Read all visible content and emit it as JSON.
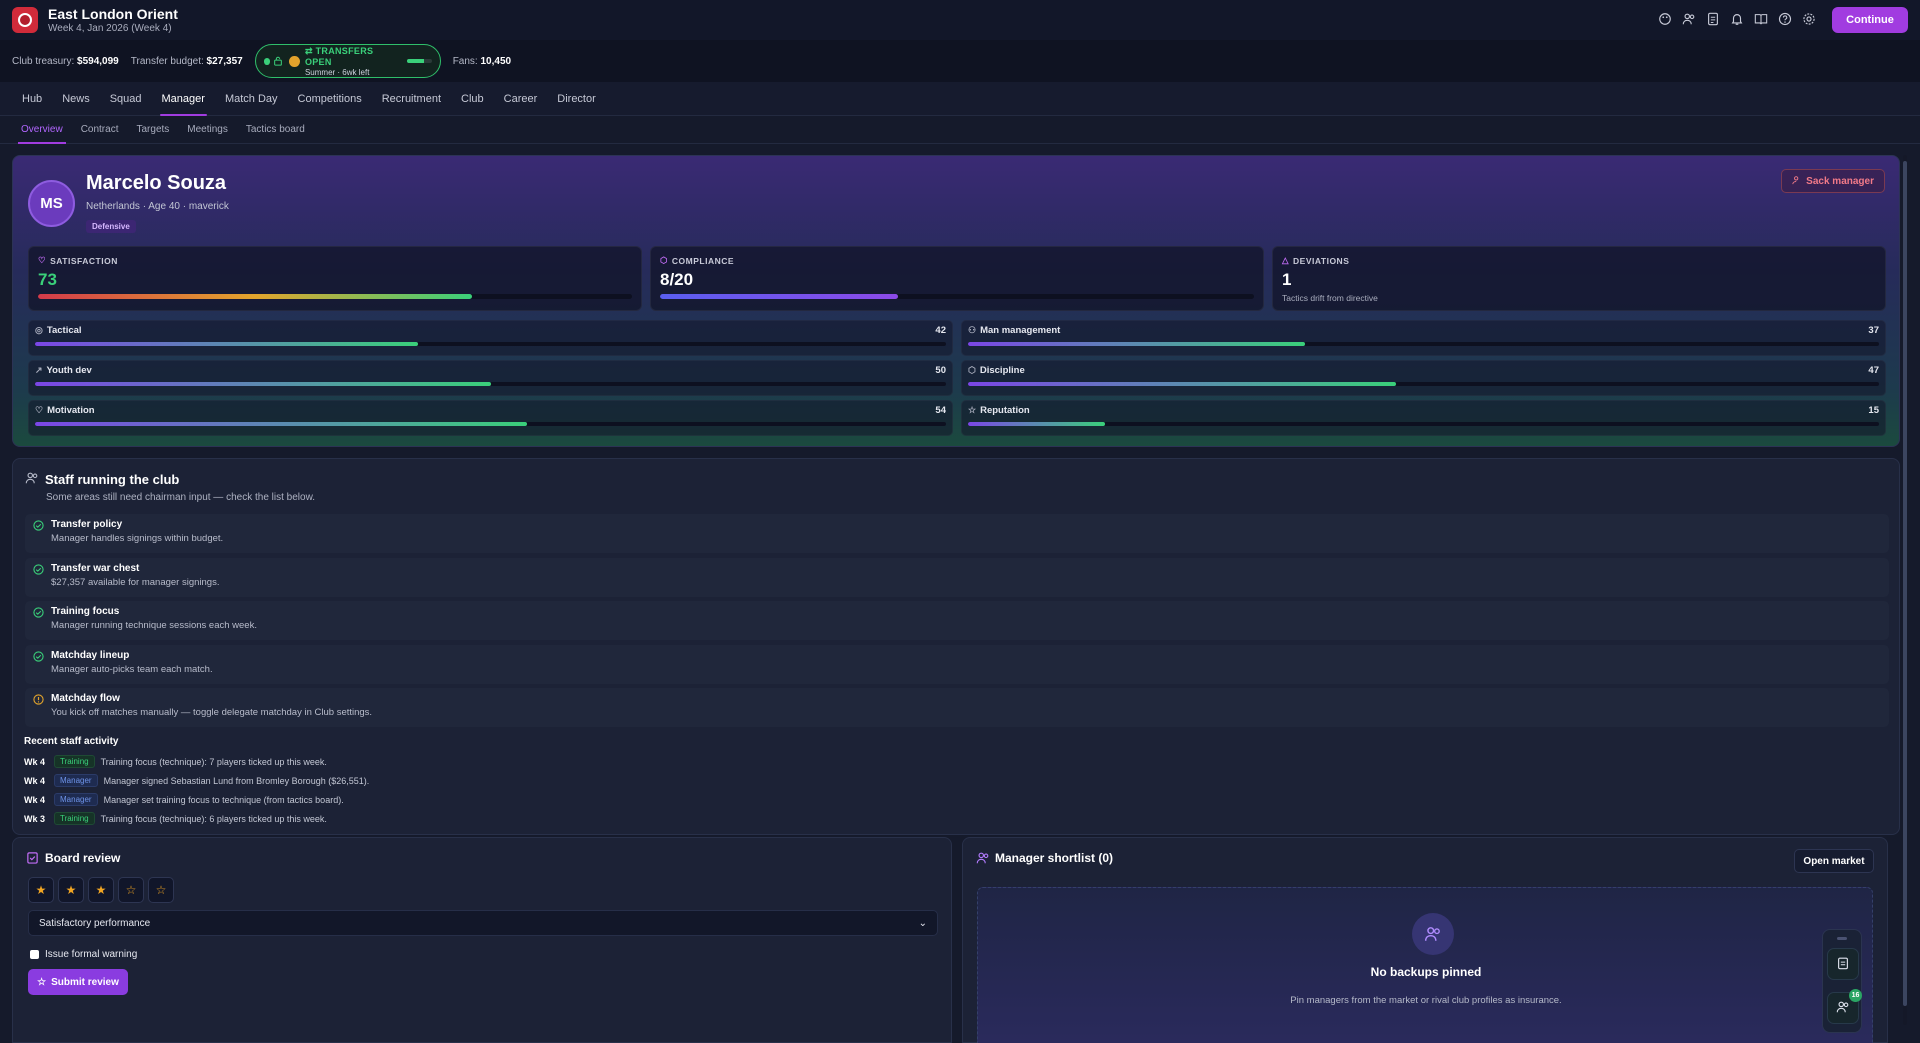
{
  "header": {
    "club_name": "East London Orient",
    "date_line": "Week 4, Jan 2026 (Week 4)",
    "continue_label": "Continue",
    "icons": [
      "palette-icon",
      "people-icon",
      "document-icon",
      "bell-icon",
      "book-icon",
      "help-icon",
      "gear-icon"
    ]
  },
  "finances": {
    "treasury_label": "Club treasury:",
    "treasury_value": "$594,099",
    "budget_label": "Transfer budget:",
    "budget_value": "$27,357",
    "transfer_status": "TRANSFERS OPEN",
    "transfer_window": "Summer · 6wk left",
    "window_progress": 0.7,
    "fans_label": "Fans:",
    "fans_value": "10,450"
  },
  "nav": {
    "items": [
      "Hub",
      "News",
      "Squad",
      "Manager",
      "Match Day",
      "Competitions",
      "Recruitment",
      "Club",
      "Career",
      "Director"
    ],
    "active": "Manager"
  },
  "subnav": {
    "items": [
      "Overview",
      "Contract",
      "Targets",
      "Meetings",
      "Tactics board"
    ],
    "active": "Overview"
  },
  "manager": {
    "initials": "MS",
    "name": "Marcelo Souza",
    "meta": "Netherlands · Age 40 · maverick",
    "style_tag": "Defensive",
    "sack_label": "Sack manager",
    "satisfaction_label": "SATISFACTION",
    "satisfaction": "73",
    "satisfaction_level": 0.73,
    "compliance_label": "COMPLIANCE",
    "compliance": "8/20",
    "compliance_level": 0.4,
    "deviations_label": "DEVIATIONS",
    "deviations": "1",
    "deviations_note": "Tactics drift from directive",
    "colors": {
      "satisfaction": "#3ad07a",
      "compliance": "#7b5cf0",
      "accent": "#a13ce0"
    }
  },
  "attributes": [
    {
      "name": "Tactical",
      "value": "42",
      "level": 0.42,
      "icon": "target-icon"
    },
    {
      "name": "Man management",
      "value": "37",
      "level": 0.37,
      "icon": "people-icon"
    },
    {
      "name": "Youth dev",
      "value": "50",
      "level": 0.5,
      "icon": "trend-icon"
    },
    {
      "name": "Discipline",
      "value": "47",
      "level": 0.47,
      "icon": "shield-icon"
    },
    {
      "name": "Motivation",
      "value": "54",
      "level": 0.54,
      "icon": "heart-icon"
    },
    {
      "name": "Reputation",
      "value": "15",
      "level": 0.15,
      "icon": "star-icon"
    }
  ],
  "staff": {
    "title": "Staff running the club",
    "subtitle": "Some areas still need chairman input — check the list below.",
    "items": [
      {
        "title": "Transfer policy",
        "desc": "Manager handles signings within budget.",
        "status": "ok"
      },
      {
        "title": "Transfer war chest",
        "desc": "$27,357 available for manager signings.",
        "status": "ok"
      },
      {
        "title": "Training focus",
        "desc": "Manager running technique sessions each week.",
        "status": "ok"
      },
      {
        "title": "Matchday lineup",
        "desc": "Manager auto-picks team each match.",
        "status": "ok"
      },
      {
        "title": "Matchday flow",
        "desc": "You kick off matches manually — toggle delegate matchday in Club settings.",
        "status": "warn"
      }
    ],
    "recent_title": "Recent staff activity",
    "activity": [
      {
        "week": "Wk 4",
        "type": "Training",
        "text": "Training focus (technique): 7 players ticked up this week."
      },
      {
        "week": "Wk 4",
        "type": "Manager",
        "text": "Manager signed Sebastian Lund from Bromley Borough ($26,551)."
      },
      {
        "week": "Wk 4",
        "type": "Manager",
        "text": "Manager set training focus to technique (from tactics board)."
      },
      {
        "week": "Wk 3",
        "type": "Training",
        "text": "Training focus (technique): 6 players ticked up this week."
      }
    ]
  },
  "board_review": {
    "title": "Board review",
    "stars_filled": 3,
    "stars_total": 5,
    "performance": "Satisfactory performance",
    "warning_label": "Issue formal warning",
    "submit_label": "Submit review"
  },
  "shortlist": {
    "title": "Manager shortlist (0)",
    "open_market_label": "Open market",
    "empty_title": "No backups pinned",
    "empty_sub": "Pin managers from the market or rival club profiles as insurance."
  },
  "floating": {
    "badge_count": "16"
  }
}
